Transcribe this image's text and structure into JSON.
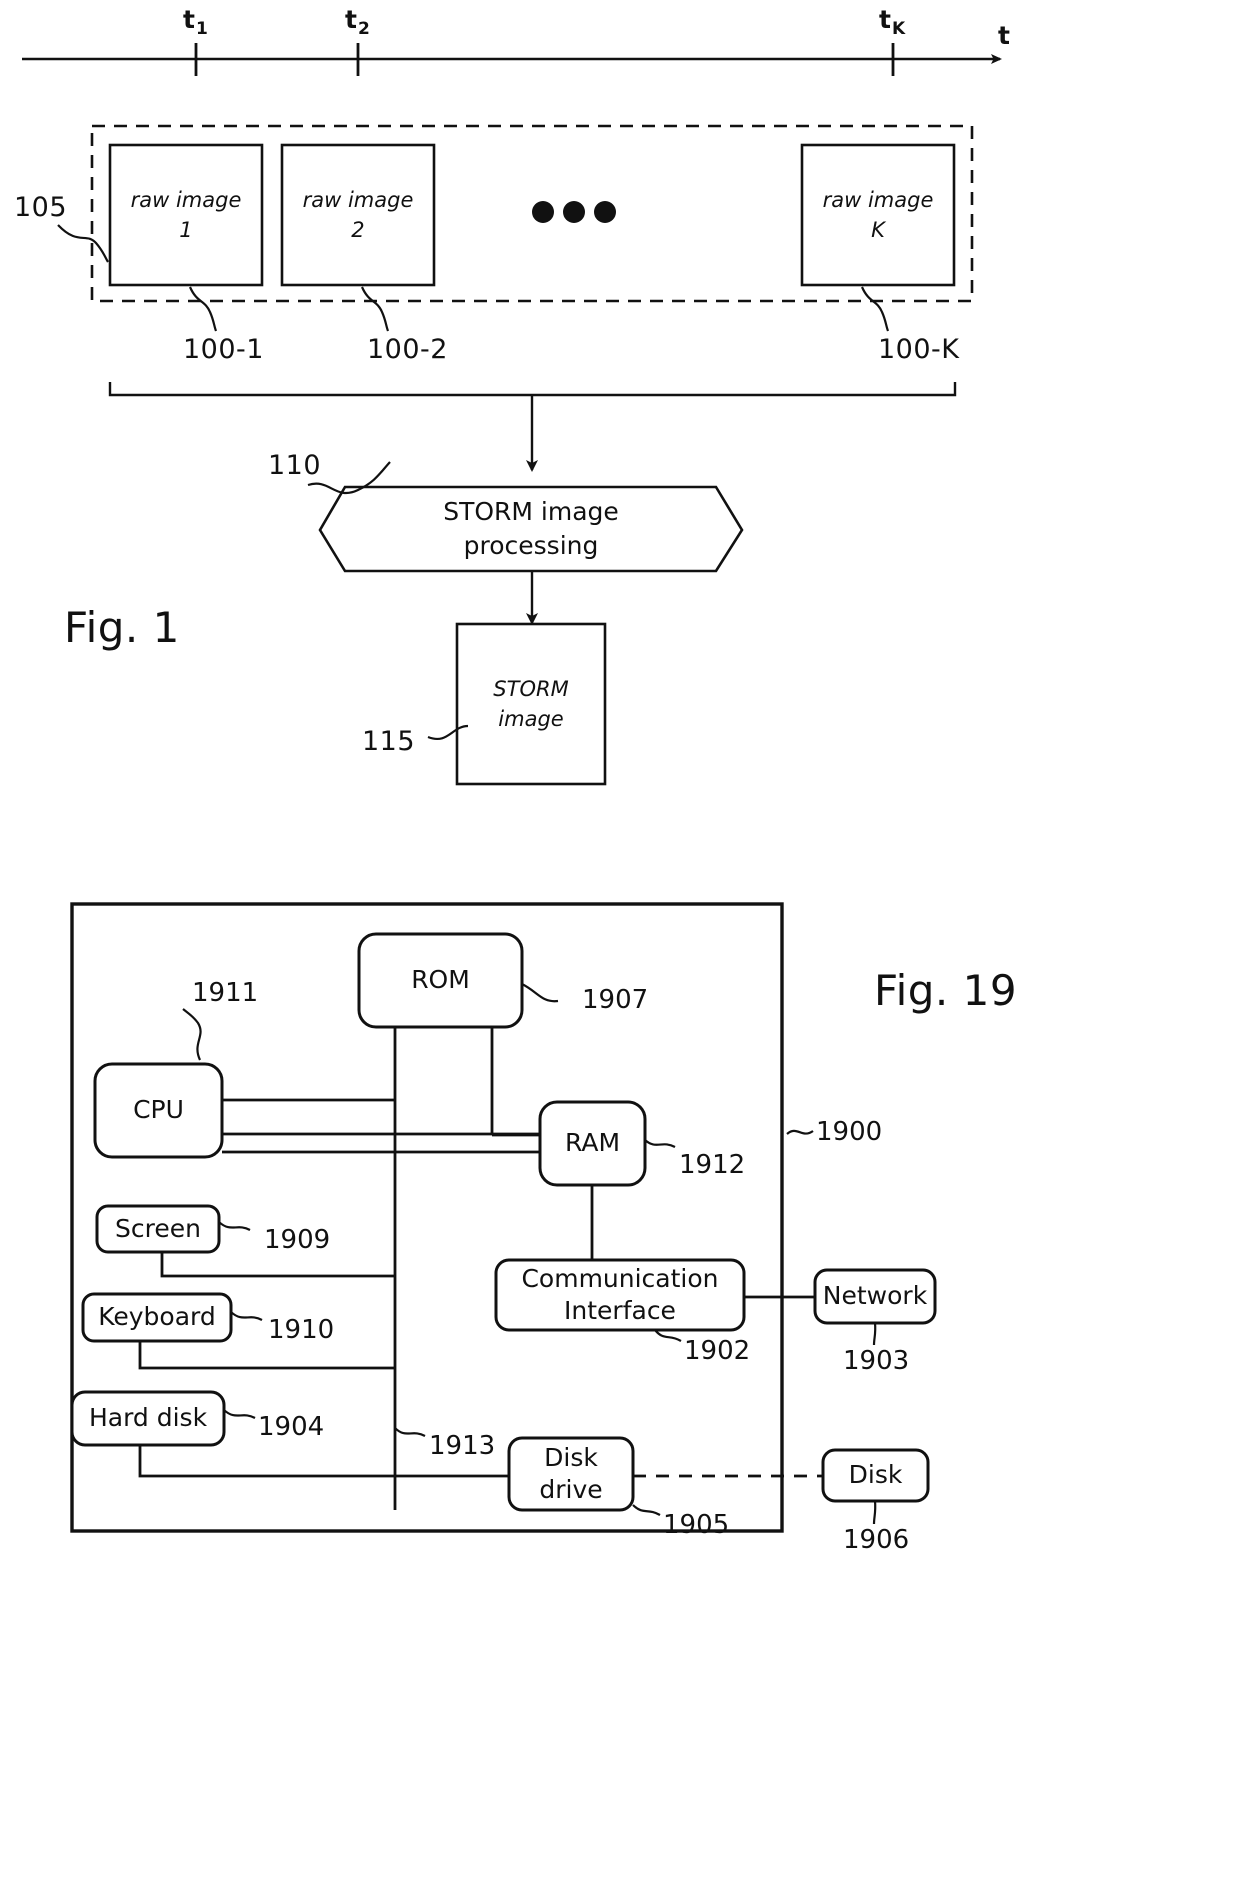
{
  "document": {
    "kind": "patent-figure-sheet",
    "figures": [
      "Fig. 1",
      "Fig. 19"
    ]
  },
  "fig1": {
    "title": "Fig. 1",
    "timeline": {
      "axis_label": "t",
      "ticks": [
        {
          "base": "t",
          "sub": "1"
        },
        {
          "base": "t",
          "sub": "2"
        },
        {
          "base": "t",
          "sub": "K"
        }
      ]
    },
    "group_ref": "105",
    "ellipsis": "•••",
    "raw_images": [
      {
        "line1": "raw image",
        "line2": "1",
        "ref": "100-1"
      },
      {
        "line1": "raw image",
        "line2": "2",
        "ref": "100-2"
      },
      {
        "line1": "raw image",
        "line2": "K",
        "ref": "100-K"
      }
    ],
    "process": {
      "line1": "STORM image",
      "line2": "processing",
      "ref": "110"
    },
    "output": {
      "line1": "STORM",
      "line2": "image",
      "ref": "115"
    }
  },
  "fig19": {
    "title": "Fig. 19",
    "system_ref": "1900",
    "bus_ref": "1913",
    "blocks": [
      {
        "id": "rom",
        "label": "ROM",
        "ref": "1907"
      },
      {
        "id": "cpu",
        "label": "CPU",
        "ref": "1911"
      },
      {
        "id": "ram",
        "label": "RAM",
        "ref": "1912"
      },
      {
        "id": "screen",
        "label": "Screen",
        "ref": "1909"
      },
      {
        "id": "keyboard",
        "label": "Keyboard",
        "ref": "1910"
      },
      {
        "id": "harddisk",
        "label": "Hard disk",
        "ref": "1904"
      },
      {
        "id": "comm",
        "label": "Communication Interface",
        "ref": "1902",
        "line1": "Communication",
        "line2": "Interface"
      },
      {
        "id": "network",
        "label": "Network",
        "ref": "1903"
      },
      {
        "id": "diskdrive",
        "label": "Disk drive",
        "ref": "1905",
        "line1": "Disk",
        "line2": "drive"
      },
      {
        "id": "disk",
        "label": "Disk",
        "ref": "1906"
      }
    ]
  },
  "colors": {
    "ink": "#111111",
    "paper": "#ffffff"
  }
}
